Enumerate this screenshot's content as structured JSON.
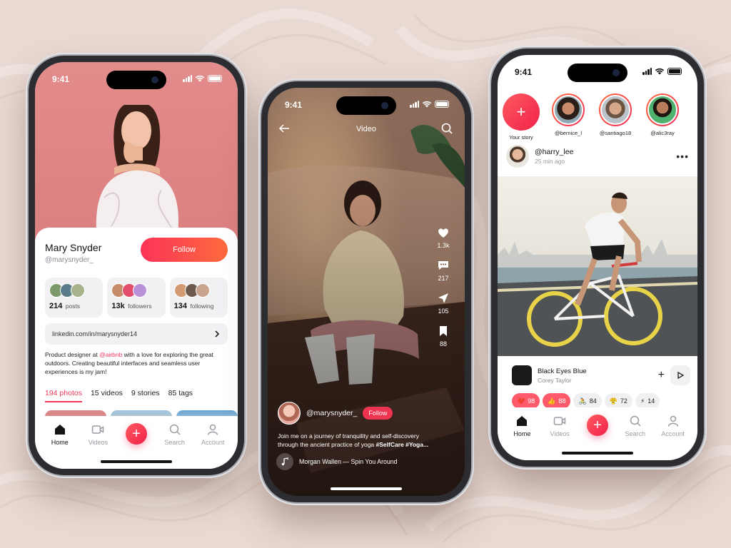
{
  "status": {
    "time": "9:41"
  },
  "profile": {
    "name": "Mary Snyder",
    "handle": "@marysnyder_",
    "follow_label": "Follow",
    "stats": [
      {
        "count": "214",
        "label": "posts"
      },
      {
        "count": "13k",
        "label": "followers"
      },
      {
        "count": "134",
        "label": "following"
      }
    ],
    "link": "linkedin.com/in/marysnyder14",
    "bio_before": "Product designer at ",
    "bio_mention": "@airbnb",
    "bio_after": " with a love for exploring the great outdoors. Creating beautiful interfaces and seamless user experiences is my jam!",
    "tabs": [
      "194 photos",
      "15 videos",
      "9 stories",
      "85 tags"
    ]
  },
  "nav": {
    "home": "Home",
    "videos": "Videos",
    "search": "Search",
    "account": "Account"
  },
  "video": {
    "title": "Video",
    "likes": "1.3k",
    "comments": "217",
    "shares": "105",
    "saves": "88",
    "user": "@marysnyder_",
    "follow_label": "Follow",
    "caption_text": "Join me on a journey of tranquility and self-discovery through the ancient practice of yoga ",
    "caption_tags": "#SelfCare #Yoga...",
    "music": "Morgan Wallen — Spin You Around"
  },
  "feed": {
    "stories": [
      {
        "name": "Your story"
      },
      {
        "name": "@bernice_l"
      },
      {
        "name": "@santiago18"
      },
      {
        "name": "@alic3ray"
      }
    ],
    "post_user": "@harry_lee",
    "post_time": "25 min ago",
    "track_title": "Black Eyes Blue",
    "track_artist": "Corey Taylor",
    "reactions": [
      {
        "emoji": "❤️",
        "count": "98"
      },
      {
        "emoji": "👍",
        "count": "88"
      },
      {
        "emoji": "🚴",
        "count": "84"
      },
      {
        "emoji": "😤",
        "count": "72"
      },
      {
        "emoji": "⚡",
        "count": "14"
      }
    ]
  },
  "colors": {
    "accent": "#ef3452",
    "accent_gradient_end": "#fe6a3d",
    "background": "#e9d9d3"
  }
}
